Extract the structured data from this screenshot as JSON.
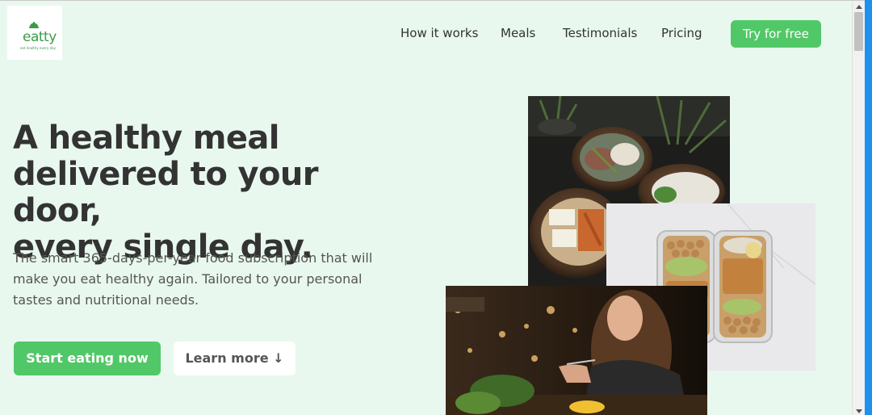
{
  "brand": {
    "name": "eatty",
    "tagline": "eat healthy every day",
    "accent_color": "#51c867"
  },
  "nav": {
    "links": [
      "How it works",
      "Meals",
      "Testimonials",
      "Pricing"
    ],
    "cta_label": "Try for free"
  },
  "hero": {
    "title_lines": [
      "A healthy meal",
      "delivered to your door,",
      "every single day."
    ],
    "subtitle": "The smart 365-days-per-year food subscription that will make you eat healthy again. Tailored to your personal tastes and nutritional needs.",
    "primary_button": "Start eating now",
    "secondary_button": "Learn more ↓"
  },
  "images": {
    "bowls": "meal-bowls-photo",
    "meal_prep": "meal-prep-containers-photo",
    "woman": "woman-eating-photo"
  }
}
